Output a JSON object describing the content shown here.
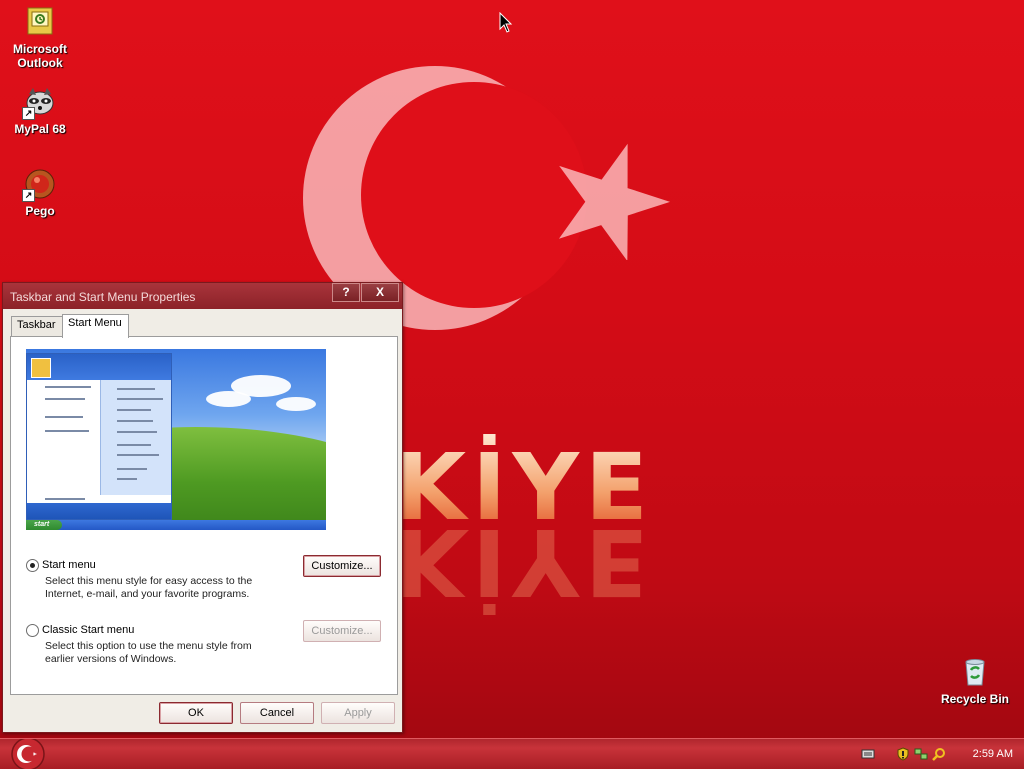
{
  "desktop": {
    "wallpaper_text": "RKİYE",
    "icons": [
      {
        "label": "Microsoft Outlook",
        "icon": "outlook-icon"
      },
      {
        "label": "MyPal 68",
        "icon": "mypal-raccoon-icon"
      },
      {
        "label": "Pego",
        "icon": "pego-icon"
      },
      {
        "label": "Recycle Bin",
        "icon": "recycle-bin-icon"
      }
    ]
  },
  "dialog": {
    "title": "Taskbar and Start Menu Properties",
    "help_label": "?",
    "close_label": "X",
    "tabs": [
      {
        "label": "Taskbar",
        "active": false
      },
      {
        "label": "Start Menu",
        "active": true
      }
    ],
    "preview": {
      "start_label": "start"
    },
    "options": [
      {
        "label": "Start menu",
        "description": "Select this menu style for easy access to the Internet, e-mail, and your favorite programs.",
        "selected": true,
        "customize_label": "Customize..."
      },
      {
        "label": "Classic Start menu",
        "description": "Select this option to use the menu style from earlier versions of Windows.",
        "selected": false,
        "customize_label": "Customize..."
      }
    ],
    "buttons": {
      "ok": "OK",
      "cancel": "Cancel",
      "apply": "Apply"
    }
  },
  "taskbar": {
    "clock": "2:59 AM",
    "tray_icons": [
      "keyboard-icon",
      "security-shield-icon",
      "network-icon",
      "search-icon"
    ]
  },
  "colors": {
    "wallpaper_red": "#d40c16",
    "taskbar_red": "#b0262d",
    "titlebar_red": "#9b2b31"
  }
}
